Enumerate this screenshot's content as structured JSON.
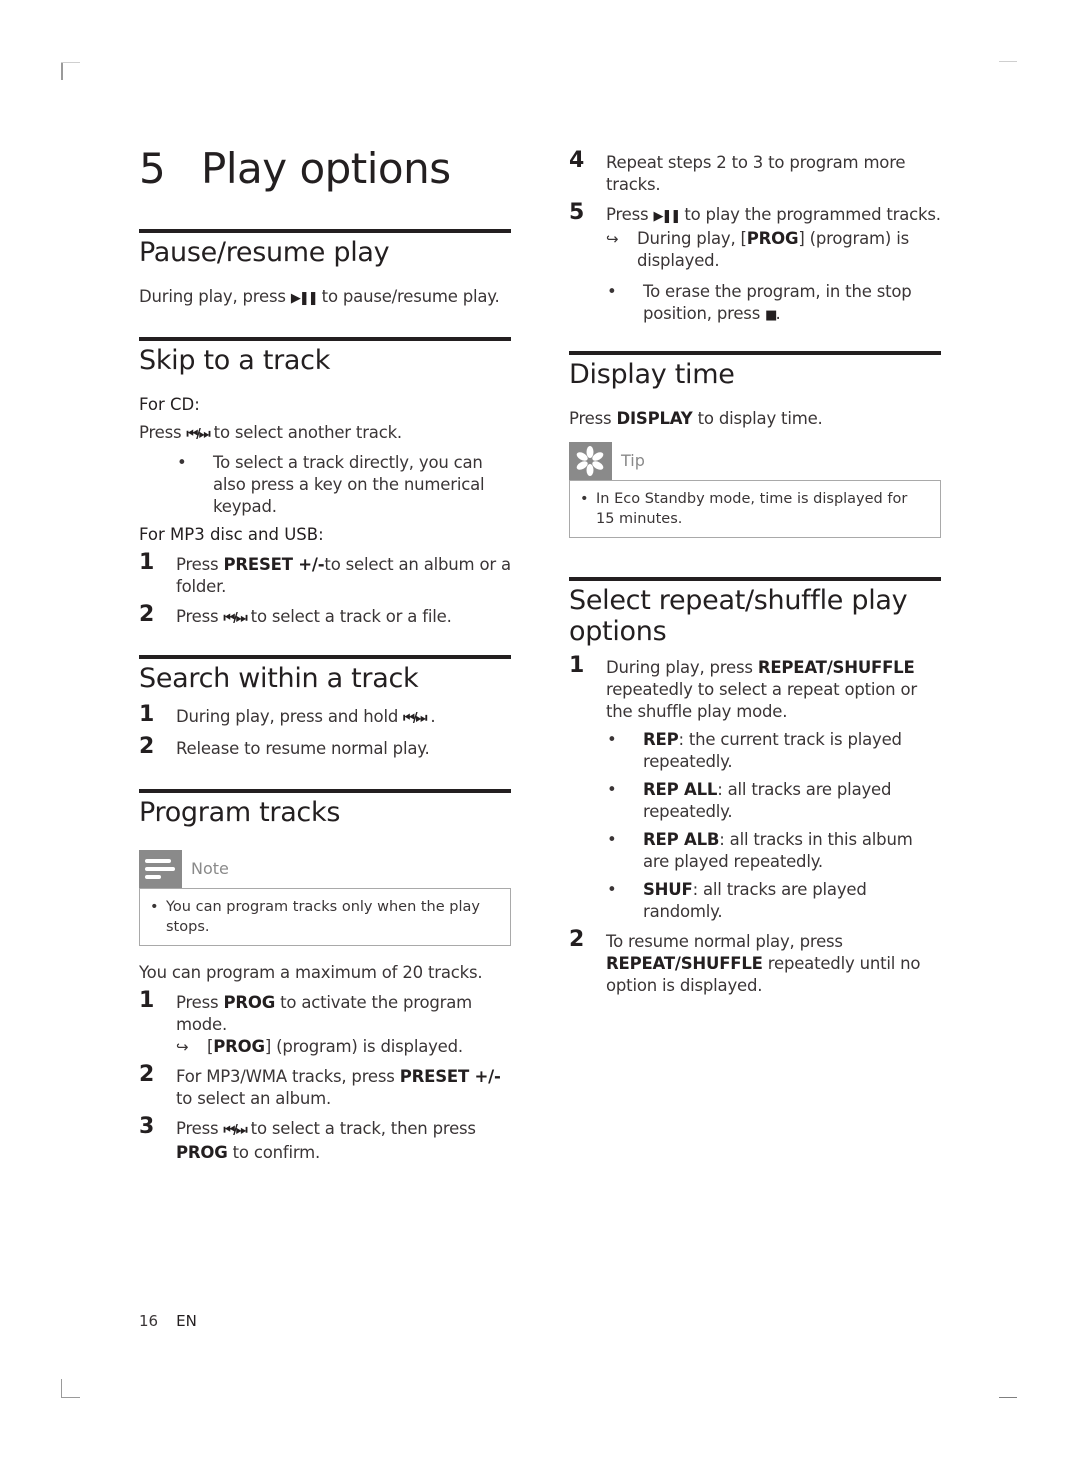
{
  "chapter": {
    "number": "5",
    "title": "Play options"
  },
  "left": {
    "pause": {
      "title": "Pause/resume play",
      "text_pre": "During play, press ",
      "icon": "play-pause-icon",
      "text_post": " to pause/resume play."
    },
    "skip": {
      "title": "Skip to a track",
      "for_cd": "For CD:",
      "cd_pre": "Press ",
      "cd_post": " to select another track.",
      "cd_bullet": "To select a track directly, you can also press a key on the numerical keypad.",
      "for_mp3_pre": "For ",
      "for_mp3_b1": "MP3",
      "for_mp3_mid": " disc and ",
      "for_mp3_b2": "USB",
      "for_mp3_post": ":",
      "steps": [
        {
          "n": "1",
          "pre": "Press ",
          "bold": "PRESET +/-",
          "post": "to select an album or a folder."
        },
        {
          "n": "2",
          "pre": "Press ",
          "post": " to select a track or a file."
        }
      ]
    },
    "search": {
      "title": "Search within a track",
      "steps": [
        {
          "n": "1",
          "pre": "During play, press and hold ",
          "post": " ."
        },
        {
          "n": "2",
          "text": "Release to resume normal play."
        }
      ]
    },
    "program": {
      "title": "Program tracks",
      "note_label": "Note",
      "note_text": "You can program tracks only when the play stops.",
      "intro": "You can program a maximum of 20 tracks.",
      "steps": [
        {
          "n": "1",
          "pre": "Press ",
          "bold": "PROG",
          "post": " to activate the program mode.",
          "result_pre": "[",
          "result_bold": "PROG",
          "result_post": "] (program) is displayed."
        },
        {
          "n": "2",
          "pre": "For MP3/WMA tracks, press ",
          "bold": "PRESET +/-",
          "post": " to select an album."
        },
        {
          "n": "3",
          "pre": "Press ",
          "mid": " to select a track, then press ",
          "bold": "PROG",
          "post": " to confirm."
        }
      ]
    }
  },
  "right": {
    "program_cont": {
      "steps": [
        {
          "n": "4",
          "text": "Repeat steps 2 to 3 to program more tracks."
        },
        {
          "n": "5",
          "pre": "Press ",
          "post": " to play the programmed tracks.",
          "result_pre": "During play, [",
          "result_bold": "PROG",
          "result_post": "] (program) is displayed."
        }
      ],
      "bullet_pre": "To erase the program, in the stop position, press ",
      "bullet_post": "."
    },
    "display": {
      "title": "Display time",
      "pre": "Press ",
      "bold": "DISPLAY",
      "post": " to display time.",
      "tip_label": "Tip",
      "tip_text": "In Eco Standby mode, time is displayed for 15 minutes."
    },
    "repeat": {
      "title": "Select repeat/shuffle play options",
      "step1_pre": "During play, press ",
      "step1_bold": "REPEAT/SHUFFLE",
      "step1_post": " repeatedly to select a repeat option or the shuffle play mode.",
      "bullets": [
        {
          "bold": "REP",
          "text": ": the current track is played repeatedly."
        },
        {
          "bold": "REP ALL",
          "text": ": all tracks are played repeatedly."
        },
        {
          "bold": "REP ALB",
          "text": ": all tracks in this album are played repeatedly."
        },
        {
          "bold": "SHUF",
          "text": ": all tracks are played randomly."
        }
      ],
      "step2_pre": "To resume normal play, press ",
      "step2_bold": "REPEAT/SHUFFLE",
      "step2_post": " repeatedly until no option is displayed."
    }
  },
  "footer": {
    "page": "16",
    "lang": "EN"
  },
  "glyphs": {
    "play_pause": "▶❚❚",
    "prev_next": "⏮/⏭",
    "stop": "■",
    "arrow": "↪",
    "bullet": "•"
  }
}
